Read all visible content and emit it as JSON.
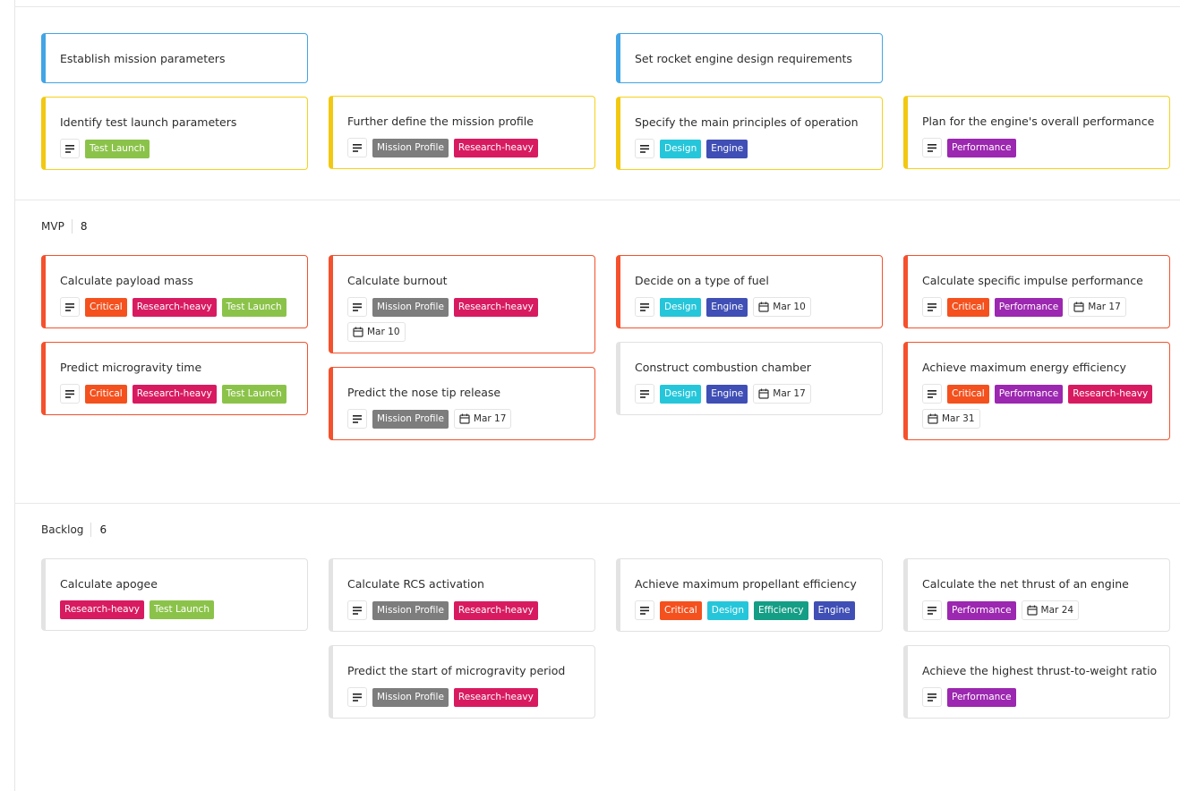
{
  "colors": {
    "Test Launch": "#8bc34a",
    "Mission Profile": "#7d7d7d",
    "Research-heavy": "#d81b60",
    "Design": "#26c6da",
    "Engine": "#3f4fb5",
    "Performance": "#9c27b0",
    "Critical": "#f4511e",
    "Efficiency": "#159e86"
  },
  "lanes": [
    {
      "name": "",
      "count": "",
      "columns": [
        [
          {
            "title": "Establish mission parameters",
            "accent": "blue",
            "desc": false,
            "tags": [],
            "date": ""
          },
          {
            "title": "Identify test launch parameters",
            "accent": "yellow",
            "desc": true,
            "tags": [
              "Test Launch"
            ],
            "date": ""
          }
        ],
        [
          {
            "title": "Further define the mission profile",
            "accent": "yellow",
            "desc": true,
            "tags": [
              "Mission Profile",
              "Research-heavy"
            ],
            "date": ""
          }
        ],
        [
          {
            "title": "Set rocket engine design requirements",
            "accent": "blue",
            "desc": false,
            "tags": [],
            "date": ""
          },
          {
            "title": "Specify the main principles of operation",
            "accent": "yellow",
            "desc": true,
            "tags": [
              "Design",
              "Engine"
            ],
            "date": ""
          }
        ],
        [
          {
            "title": "Plan for the engine's overall performance",
            "accent": "yellow",
            "desc": true,
            "tags": [
              "Performance"
            ],
            "date": ""
          }
        ]
      ]
    },
    {
      "name": "MVP",
      "count": "8",
      "columns": [
        [
          {
            "title": "Calculate payload mass",
            "accent": "red",
            "desc": true,
            "tags": [
              "Critical",
              "Research-heavy",
              "Test Launch"
            ],
            "date": ""
          },
          {
            "title": "Predict microgravity time",
            "accent": "red",
            "desc": true,
            "tags": [
              "Critical",
              "Research-heavy",
              "Test Launch"
            ],
            "date": ""
          }
        ],
        [
          {
            "title": "Calculate burnout",
            "accent": "red",
            "desc": true,
            "tags": [
              "Mission Profile",
              "Research-heavy"
            ],
            "date": "Mar 10"
          },
          {
            "title": "Predict the nose tip release",
            "accent": "red",
            "desc": true,
            "tags": [
              "Mission Profile"
            ],
            "date": "Mar 17"
          }
        ],
        [
          {
            "title": "Decide on a type of fuel",
            "accent": "red",
            "desc": true,
            "tags": [
              "Design",
              "Engine"
            ],
            "date": "Mar 10"
          },
          {
            "title": "Construct combustion chamber",
            "accent": "gray",
            "desc": true,
            "tags": [
              "Design",
              "Engine"
            ],
            "date": "Mar 17"
          }
        ],
        [
          {
            "title": "Calculate specific impulse performance",
            "accent": "red",
            "desc": true,
            "tags": [
              "Critical",
              "Performance"
            ],
            "date": "Mar 17"
          },
          {
            "title": "Achieve maximum energy efficiency",
            "accent": "red",
            "desc": true,
            "tags": [
              "Critical",
              "Performance",
              "Research-heavy"
            ],
            "date": "Mar 31"
          }
        ]
      ]
    },
    {
      "name": "Backlog",
      "count": "6",
      "columns": [
        [
          {
            "title": "Calculate apogee",
            "accent": "gray",
            "desc": false,
            "tags": [
              "Research-heavy",
              "Test Launch"
            ],
            "date": ""
          }
        ],
        [
          {
            "title": "Calculate RCS activation",
            "accent": "gray",
            "desc": true,
            "tags": [
              "Mission Profile",
              "Research-heavy"
            ],
            "date": ""
          },
          {
            "title": "Predict the start of microgravity period",
            "accent": "gray",
            "desc": true,
            "tags": [
              "Mission Profile",
              "Research-heavy"
            ],
            "date": ""
          }
        ],
        [
          {
            "title": "Achieve maximum propellant efficiency",
            "accent": "gray",
            "desc": true,
            "tags": [
              "Critical",
              "Design",
              "Efficiency",
              "Engine"
            ],
            "date": ""
          }
        ],
        [
          {
            "title": "Calculate the net thrust of an engine",
            "accent": "gray",
            "desc": true,
            "tags": [
              "Performance"
            ],
            "date": "Mar 24"
          },
          {
            "title": "Achieve the highest thrust-to-weight ratio",
            "accent": "gray",
            "desc": true,
            "tags": [
              "Performance"
            ],
            "date": ""
          }
        ]
      ]
    }
  ]
}
